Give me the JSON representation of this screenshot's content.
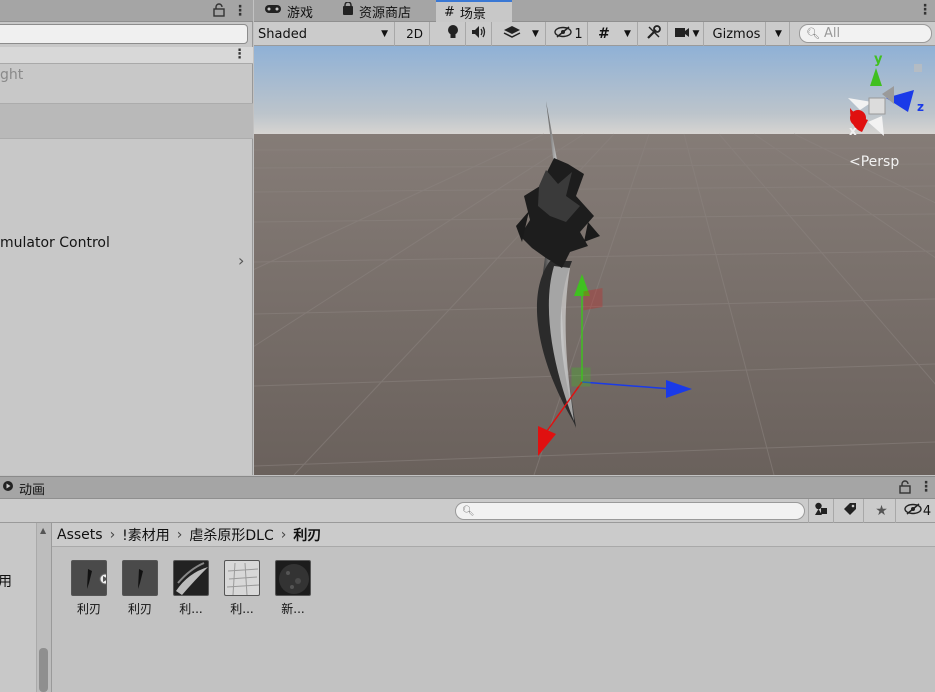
{
  "left_panel": {
    "partial_text_1": "ght",
    "partial_text_2": "mulator Control"
  },
  "scene_tabs": [
    {
      "label": "游戏",
      "icon": "gamepad-icon"
    },
    {
      "label": "资源商店",
      "icon": "store-bag-icon"
    },
    {
      "label": "场景",
      "icon": "grid-hash-icon",
      "active": true
    }
  ],
  "scene_toolbar": {
    "shading_mode": "Shaded",
    "mode_2d": "2D",
    "hidden_count": "1",
    "gizmos_label": "Gizmos",
    "search_placeholder": "All"
  },
  "viewport": {
    "projection_label": "<Persp",
    "axis_labels": {
      "y": "y",
      "x": "x",
      "z": "z"
    }
  },
  "project_panel": {
    "tab_label": "动画",
    "tree_partial_text": "用",
    "hidden_count": "4",
    "breadcrumb": [
      "Assets",
      "!素材用",
      "虐杀原形DLC",
      "利刃"
    ],
    "assets": [
      {
        "label": "利刃",
        "kind": "prefab-expandable"
      },
      {
        "label": "利刃",
        "kind": "prefab"
      },
      {
        "label": "利...",
        "kind": "texture-blade"
      },
      {
        "label": "利...",
        "kind": "texture-light"
      },
      {
        "label": "新...",
        "kind": "texture-dark"
      }
    ]
  },
  "colors": {
    "selection_tab_accent": "#3a78d4",
    "axis_x": "#e01010",
    "axis_y": "#40c020",
    "axis_z": "#1a3ae8"
  }
}
